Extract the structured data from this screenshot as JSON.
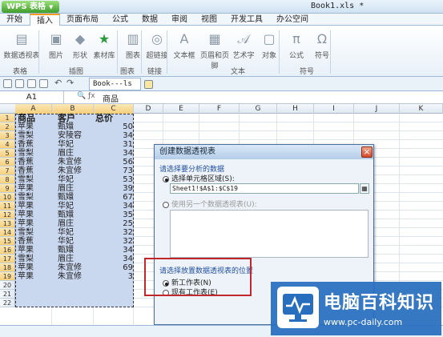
{
  "app": {
    "brand": "WPS 表格",
    "doc_title": "Book1.xls *"
  },
  "menu": [
    "开始",
    "插入",
    "页面布局",
    "公式",
    "数据",
    "审阅",
    "视图",
    "开发工具",
    "办公空间"
  ],
  "ribbon": {
    "buttons": [
      "数据透视表",
      "图片",
      "形状",
      "素材库",
      "图表",
      "超链接",
      "文本框",
      "页眉和页脚",
      "艺术字",
      "对象",
      "公式",
      "符号"
    ],
    "groups": [
      "表格",
      "插图",
      "图表",
      "链接",
      "文本",
      "符号"
    ]
  },
  "tabbar": {
    "book": "Book---ls ■ ×"
  },
  "formula": {
    "name": "A1",
    "content": "商品"
  },
  "columns": [
    "A",
    "B",
    "C",
    "D",
    "E",
    "F",
    "G",
    "H",
    "I",
    "J",
    "K"
  ],
  "rows": [
    "1",
    "2",
    "3",
    "4",
    "5",
    "6",
    "7",
    "8",
    "9",
    "10",
    "11",
    "12",
    "13",
    "14",
    "15",
    "16",
    "17",
    "18",
    "19",
    "20",
    "21",
    "22"
  ],
  "sheet": {
    "headers": [
      "商品",
      "客户",
      "总价"
    ],
    "data": [
      [
        "苹果",
        "甄嬛",
        "50"
      ],
      [
        "雪梨",
        "安陵容",
        "34"
      ],
      [
        "香蕉",
        "华妃",
        "31"
      ],
      [
        "雪梨",
        "眉庄",
        "34"
      ],
      [
        "香蕉",
        "朱宜修",
        "56"
      ],
      [
        "香蕉",
        "朱宜修",
        "73"
      ],
      [
        "雪梨",
        "华妃",
        "53"
      ],
      [
        "苹果",
        "眉庄",
        "39"
      ],
      [
        "雪梨",
        "甄嬛",
        "67"
      ],
      [
        "苹果",
        "华妃",
        "34"
      ],
      [
        "苹果",
        "甄嬛",
        "35"
      ],
      [
        "苹果",
        "眉庄",
        "25"
      ],
      [
        "雪梨",
        "华妃",
        "32"
      ],
      [
        "香蕉",
        "华妃",
        "32"
      ],
      [
        "苹果",
        "甄嬛",
        "34"
      ],
      [
        "雪梨",
        "眉庄",
        "34"
      ],
      [
        "苹果",
        "朱宜修",
        "69"
      ],
      [
        "苹果",
        "朱宜修",
        "3"
      ]
    ]
  },
  "dialog": {
    "title": "创建数据透视表",
    "section1": "请选择要分析的数据",
    "opt_range": "选择单元格区域(S):",
    "range_value": "Sheet1!$A$1:$C$19",
    "opt_other": "使用另一个数据透视表(U):",
    "section2": "请选择放置数据透视表的位置",
    "opt_new": "新工作表(N)",
    "opt_exist": "现有工作表(E)"
  },
  "watermark": {
    "title": "电脑百科知识",
    "url": "www.pc-daily.com"
  },
  "colors": {
    "accent": "#f59a23",
    "selection": "#c9d7ef",
    "highlight_box": "#c0262a",
    "logo_bg": "#286ebe"
  }
}
